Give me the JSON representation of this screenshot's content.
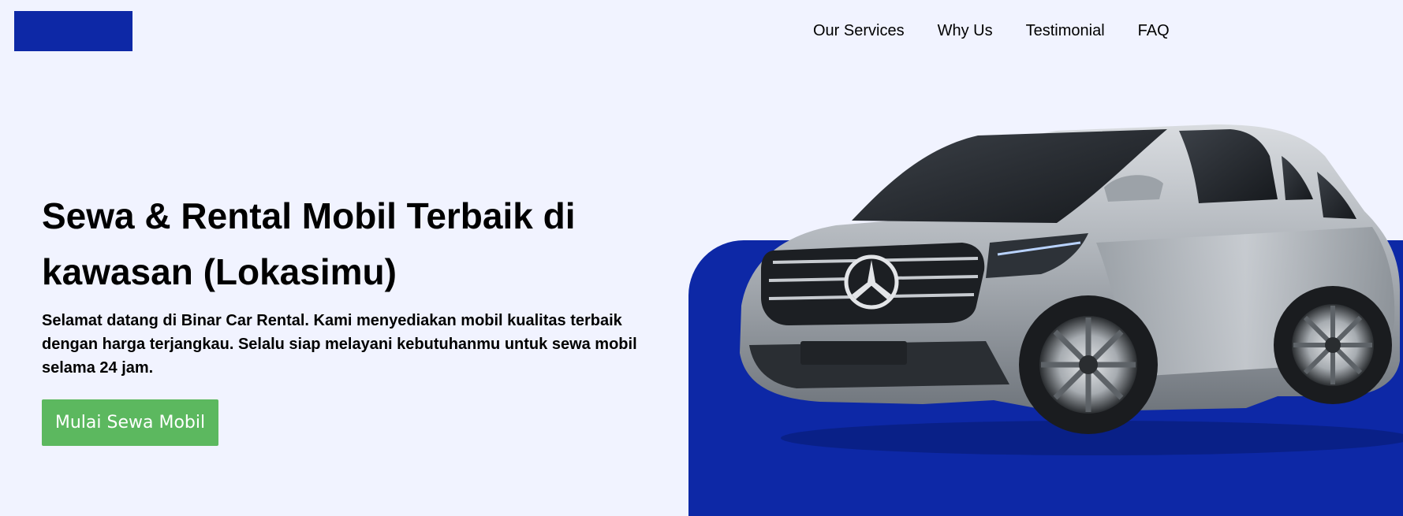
{
  "nav": {
    "items": [
      "Our Services",
      "Why Us",
      "Testimonial",
      "FAQ"
    ]
  },
  "hero": {
    "title": "Sewa & Rental Mobil Terbaik di kawasan (Lokasimu)",
    "description": "Selamat datang di Binar Car Rental. Kami menyediakan mobil kualitas terbaik dengan harga terjangkau. Selalu siap melayani kebutuhanmu untuk sewa mobil selama 24 jam.",
    "cta_label": "Mulai Sewa Mobil"
  },
  "colors": {
    "background": "#F1F3FF",
    "brand_blue": "#0D28A6",
    "cta_green": "#5CB85F"
  },
  "icons": {
    "car_image": "car-image",
    "logo": "logo-block"
  }
}
